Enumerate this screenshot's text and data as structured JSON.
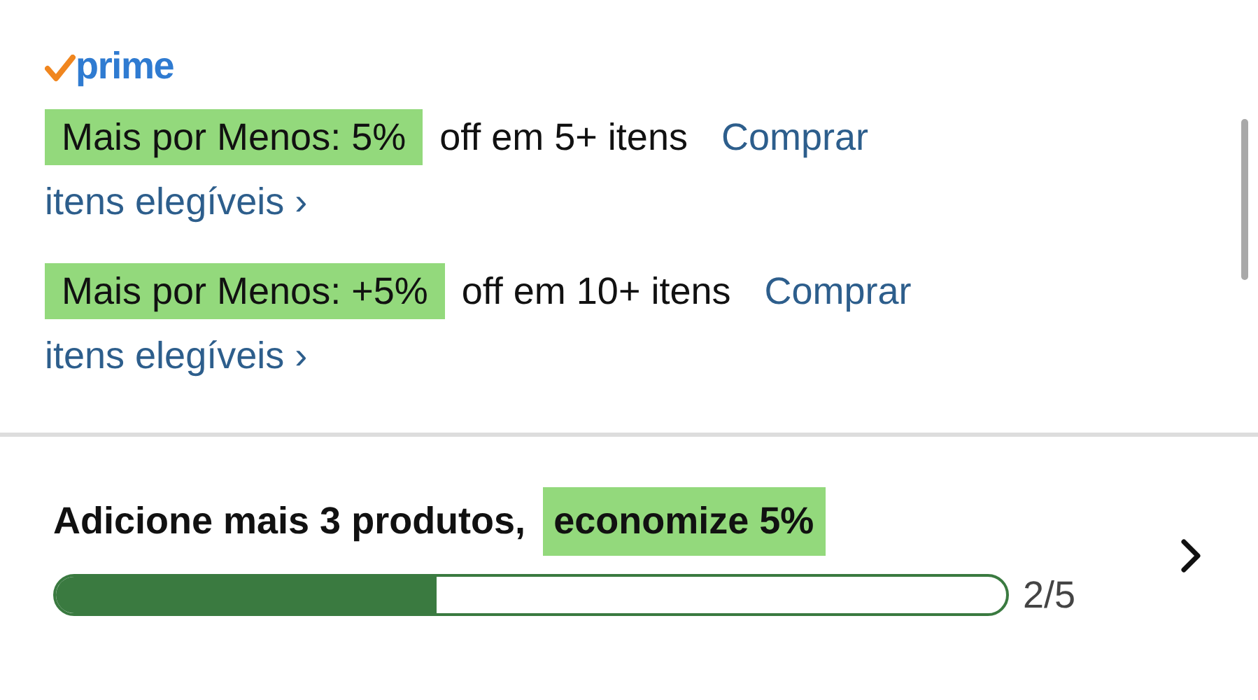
{
  "logo": {
    "text": "prime"
  },
  "deals": [
    {
      "badge": "Mais por Menos: 5%",
      "text": "off em 5+ itens",
      "link_lines": [
        "Comprar",
        "itens elegíveis ›"
      ]
    },
    {
      "badge": "Mais por Menos: +5%",
      "text": "off em 10+ itens",
      "link_lines": [
        "Comprar",
        "itens elegíveis ›"
      ]
    }
  ],
  "progress": {
    "message": "Adicione mais 3 produtos,",
    "badge": "economize 5%",
    "level": 0.4,
    "reading": "2/5"
  }
}
